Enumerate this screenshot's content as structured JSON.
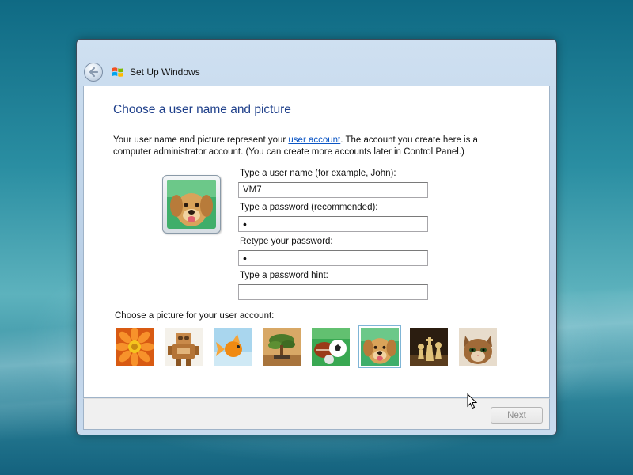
{
  "window": {
    "title": "Set Up Windows"
  },
  "page": {
    "heading": "Choose a user name and picture",
    "intro_before_link": "Your user name and picture represent your ",
    "intro_link": "user account",
    "intro_after_link": ". The account you create here is a computer administrator account. (You can create more accounts later in Control Panel.)"
  },
  "form": {
    "username_label": "Type a user name (for example, John):",
    "username_value": "VM7",
    "password_label": "Type a password (recommended):",
    "password_value": "•",
    "retype_label": "Retype your password:",
    "retype_value": "•",
    "hint_label": "Type a password hint:",
    "hint_value": ""
  },
  "pictures": {
    "label": "Choose a picture for your user account:",
    "items": [
      {
        "name": "flower-picture"
      },
      {
        "name": "robot-picture"
      },
      {
        "name": "goldfish-picture"
      },
      {
        "name": "bonsai-picture"
      },
      {
        "name": "sports-balls-picture"
      },
      {
        "name": "dog-picture",
        "selected": true
      },
      {
        "name": "chess-picture"
      },
      {
        "name": "kitten-picture"
      }
    ],
    "selected_index": 5
  },
  "footer": {
    "next_label": "Next"
  },
  "icons": {
    "back": "back-arrow-icon",
    "logo": "windows-logo-icon",
    "cursor": "mouse-pointer-icon"
  },
  "colors": {
    "heading": "#1e3f8a",
    "link": "#0b55c4",
    "selection": "#7fb5d6"
  }
}
